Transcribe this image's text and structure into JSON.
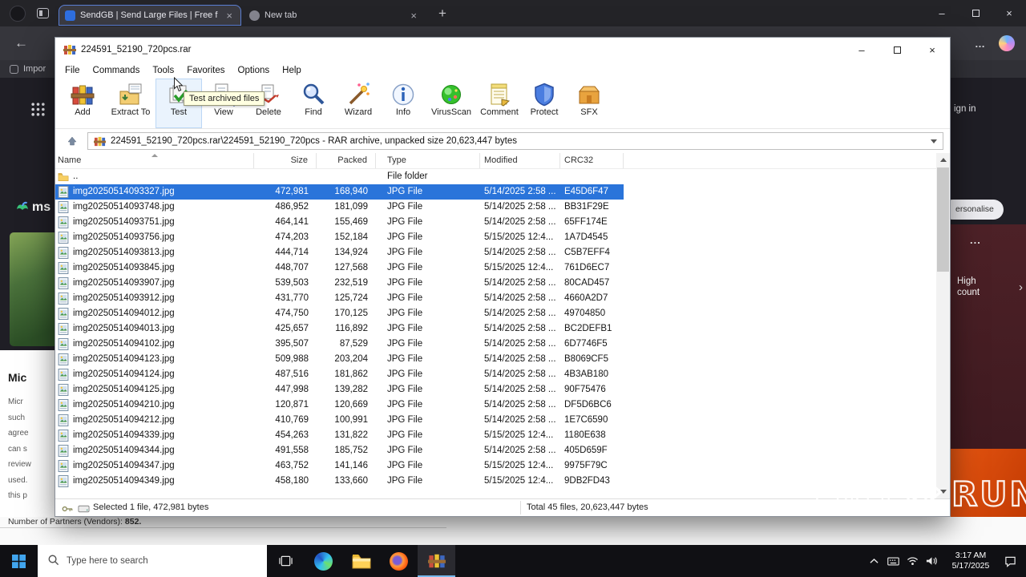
{
  "browser": {
    "tabs": [
      {
        "title": "SendGB | Send Large Files | Free f"
      },
      {
        "title": "New tab"
      }
    ],
    "bookmarks_import": "Impor",
    "page": {
      "sign_in": "ign in",
      "personalise": "ersonalise",
      "logo_text": "ms",
      "more_dots": "...",
      "high_count": "High count",
      "article_title": "Mic",
      "article_lines": [
        "Micr",
        "such",
        "agree",
        "can s",
        "review",
        "used.",
        "this p"
      ],
      "partners_label": "Number of Partners (Vendors): ",
      "partners_value": "852."
    }
  },
  "winrar": {
    "title": "224591_52190_720pcs.rar",
    "menu": [
      "File",
      "Commands",
      "Tools",
      "Favorites",
      "Options",
      "Help"
    ],
    "toolbar": [
      {
        "label": "Add",
        "icon": "add"
      },
      {
        "label": "Extract To",
        "icon": "extract"
      },
      {
        "label": "Test",
        "icon": "test",
        "hover": true
      },
      {
        "label": "View",
        "icon": "view"
      },
      {
        "label": "Delete",
        "icon": "delete"
      },
      {
        "label": "Find",
        "icon": "find"
      },
      {
        "label": "Wizard",
        "icon": "wizard"
      },
      {
        "label": "Info",
        "icon": "info"
      },
      {
        "label": "VirusScan",
        "icon": "virus"
      },
      {
        "label": "Comment",
        "icon": "comment"
      },
      {
        "label": "Protect",
        "icon": "protect"
      },
      {
        "label": "SFX",
        "icon": "sfx"
      }
    ],
    "tooltip": "Test archived files",
    "address": "224591_52190_720pcs.rar\\224591_52190_720pcs - RAR archive, unpacked size 20,623,447 bytes",
    "columns": [
      "Name",
      "Size",
      "Packed",
      "Type",
      "Modified",
      "CRC32"
    ],
    "parent_row": {
      "name": "..",
      "type": "File folder"
    },
    "files": [
      {
        "name": "img20250514093327.jpg",
        "size": "472,981",
        "packed": "168,940",
        "type": "JPG File",
        "modified": "5/14/2025 2:58 ...",
        "crc": "E45D6F47",
        "selected": true
      },
      {
        "name": "img20250514093748.jpg",
        "size": "486,952",
        "packed": "181,099",
        "type": "JPG File",
        "modified": "5/14/2025 2:58 ...",
        "crc": "BB31F29E"
      },
      {
        "name": "img20250514093751.jpg",
        "size": "464,141",
        "packed": "155,469",
        "type": "JPG File",
        "modified": "5/14/2025 2:58 ...",
        "crc": "65FF174E"
      },
      {
        "name": "img20250514093756.jpg",
        "size": "474,203",
        "packed": "152,184",
        "type": "JPG File",
        "modified": "5/15/2025 12:4...",
        "crc": "1A7D4545"
      },
      {
        "name": "img20250514093813.jpg",
        "size": "444,714",
        "packed": "134,924",
        "type": "JPG File",
        "modified": "5/14/2025 2:58 ...",
        "crc": "C5B7EFF4"
      },
      {
        "name": "img20250514093845.jpg",
        "size": "448,707",
        "packed": "127,568",
        "type": "JPG File",
        "modified": "5/15/2025 12:4...",
        "crc": "761D6EC7"
      },
      {
        "name": "img20250514093907.jpg",
        "size": "539,503",
        "packed": "232,519",
        "type": "JPG File",
        "modified": "5/14/2025 2:58 ...",
        "crc": "80CAD457"
      },
      {
        "name": "img20250514093912.jpg",
        "size": "431,770",
        "packed": "125,724",
        "type": "JPG File",
        "modified": "5/14/2025 2:58 ...",
        "crc": "4660A2D7"
      },
      {
        "name": "img20250514094012.jpg",
        "size": "474,750",
        "packed": "170,125",
        "type": "JPG File",
        "modified": "5/14/2025 2:58 ...",
        "crc": "49704850"
      },
      {
        "name": "img20250514094013.jpg",
        "size": "425,657",
        "packed": "116,892",
        "type": "JPG File",
        "modified": "5/14/2025 2:58 ...",
        "crc": "BC2DEFB1"
      },
      {
        "name": "img20250514094102.jpg",
        "size": "395,507",
        "packed": "87,529",
        "type": "JPG File",
        "modified": "5/14/2025 2:58 ...",
        "crc": "6D7746F5"
      },
      {
        "name": "img20250514094123.jpg",
        "size": "509,988",
        "packed": "203,204",
        "type": "JPG File",
        "modified": "5/14/2025 2:58 ...",
        "crc": "B8069CF5"
      },
      {
        "name": "img20250514094124.jpg",
        "size": "487,516",
        "packed": "181,862",
        "type": "JPG File",
        "modified": "5/14/2025 2:58 ...",
        "crc": "4B3AB180"
      },
      {
        "name": "img20250514094125.jpg",
        "size": "447,998",
        "packed": "139,282",
        "type": "JPG File",
        "modified": "5/14/2025 2:58 ...",
        "crc": "90F75476"
      },
      {
        "name": "img20250514094210.jpg",
        "size": "120,871",
        "packed": "120,669",
        "type": "JPG File",
        "modified": "5/14/2025 2:58 ...",
        "crc": "DF5D6BC6"
      },
      {
        "name": "img20250514094212.jpg",
        "size": "410,769",
        "packed": "100,991",
        "type": "JPG File",
        "modified": "5/14/2025 2:58 ...",
        "crc": "1E7C6590"
      },
      {
        "name": "img20250514094339.jpg",
        "size": "454,263",
        "packed": "131,822",
        "type": "JPG File",
        "modified": "5/15/2025 12:4...",
        "crc": "1180E638"
      },
      {
        "name": "img20250514094344.jpg",
        "size": "491,558",
        "packed": "185,752",
        "type": "JPG File",
        "modified": "5/14/2025 2:58 ...",
        "crc": "405D659F"
      },
      {
        "name": "img20250514094347.jpg",
        "size": "463,752",
        "packed": "141,146",
        "type": "JPG File",
        "modified": "5/15/2025 12:4...",
        "crc": "9975F79C"
      },
      {
        "name": "img20250514094349.jpg",
        "size": "458,180",
        "packed": "133,660",
        "type": "JPG File",
        "modified": "5/15/2025 12:4...",
        "crc": "9DB2FD43"
      }
    ],
    "status_selected": "Selected 1 file, 472,981 bytes",
    "status_total": "Total 45 files, 20,623,447 bytes"
  },
  "taskbar": {
    "search_placeholder": "Type here to search",
    "clock_time": "3:17 AM",
    "clock_date": "5/17/2025"
  },
  "watermark": {
    "left": "ANY",
    "right": "RUN"
  }
}
